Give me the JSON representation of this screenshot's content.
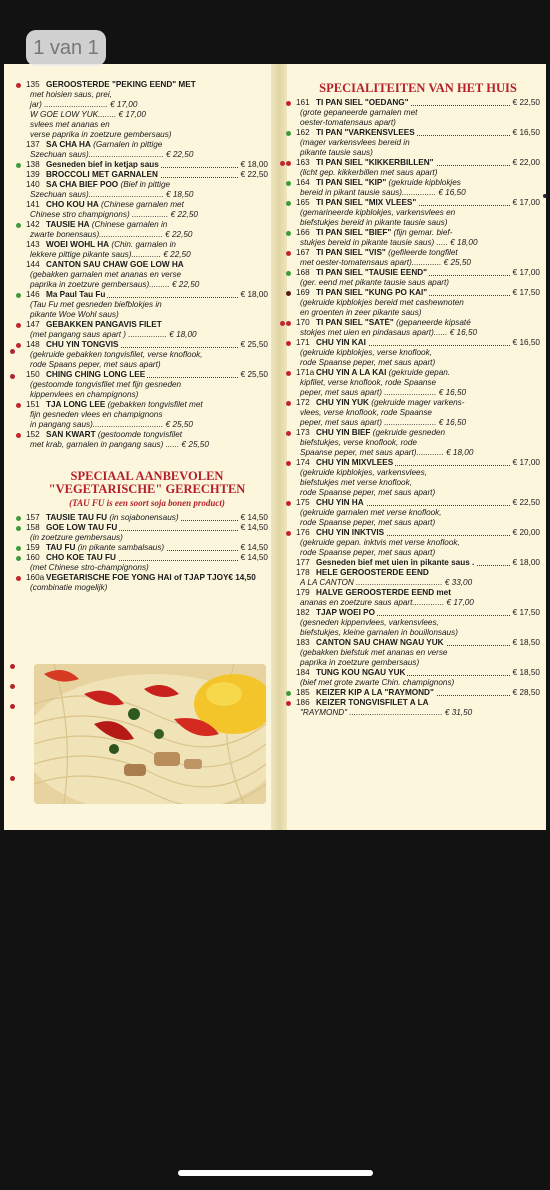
{
  "page_indicator": "1 van 1",
  "right_section": {
    "title": "SPECIALITEITEN VAN HET HUIS"
  },
  "veg_section": {
    "title1": "SPECIAAL AANBEVOLEN",
    "title2": "\"VEGETARISCHE\" GERECHTEN",
    "subtitle": "(TAU FU is een soort soja bonen product)"
  },
  "photo_icon": "food-photo-noodles",
  "colors": {
    "accent_red": "#b51f2a",
    "bullet_green": "#3f9a3a",
    "paper": "#fbf6dc"
  },
  "left_items": [
    {
      "num": "135",
      "name": "GEROOSTERDE \"PEKING EEND\" MET",
      "desc": "",
      "price": "",
      "more": [
        "met hoisien saus, prei,",
        "jar) ............................ € 17,00",
        "W GOE LOW YUK........ € 17,00",
        "svlees met ananas en",
        "verse paprika in zoetzure gembersaus)"
      ]
    },
    {
      "num": "137",
      "name": "SA CHA HA",
      "desc": "(Garnalen in pittige",
      "price": "",
      "more": [
        "Szechuan saus)................................. € 22,50"
      ]
    },
    {
      "num": "138",
      "name": "Gesneden bief in ketjap saus",
      "desc": "",
      "price": "€ 18,00",
      "more": []
    },
    {
      "num": "139",
      "name": "BROCCOLI MET GARNALEN",
      "desc": "",
      "price": "€ 22,50",
      "more": []
    },
    {
      "num": "140",
      "name": "SA CHA BIEF POO",
      "desc": "(Bief in pittige",
      "price": "",
      "more": [
        "Szechuan saus)................................. € 18,50"
      ]
    },
    {
      "num": "141",
      "name": "CHO KOU HA",
      "desc": "(Chinese garnalen met",
      "price": "",
      "more": [
        "Chinese stro champignons) ................ € 22,50"
      ]
    },
    {
      "num": "142",
      "name": "TAUSIE HA",
      "desc": "(Chinese garnalen in",
      "price": "",
      "more": [
        "zwarte bonensaus)............................ € 22,50"
      ]
    },
    {
      "num": "143",
      "name": "WOEI WOHL HA",
      "desc": "(Chin. garnalen in",
      "price": "",
      "more": [
        "lekkere pittige pikante saus)............. € 22,50"
      ]
    },
    {
      "num": "144",
      "name": "CANTON SAU CHAW GOE LOW HA",
      "desc": "",
      "price": "",
      "more": [
        "(gebakken garnalen met ananas en verse",
        "paprika in zoetzure gembersaus)......... € 22,50"
      ]
    },
    {
      "num": "146",
      "name": "Ma Paul Tau Fu",
      "desc": "",
      "price": "€ 18,00",
      "more": [
        "(Tau Fu met gesneden biefblokjes in",
        "pikante Woe Wohl saus)"
      ]
    },
    {
      "num": "147",
      "name": "GEBAKKEN PANGAVIS FILET",
      "desc": "",
      "price": "",
      "more": [
        "(met pangang saus apart ) ................. € 18,00"
      ]
    },
    {
      "num": "148",
      "name": "CHU YIN TONGVIS",
      "desc": "",
      "price": "€ 25,50",
      "more": [
        "(gekruide gebakken tongvisfilet, verse knoflook,",
        "rode Spaans peper, met saus apart)"
      ]
    },
    {
      "num": "150",
      "name": "CHING CHING LONG LEE",
      "desc": "",
      "price": "€ 25,50",
      "more": [
        "(gestoomde tongvisfilet met fijn gesneden",
        "kippenvlees en champignons)"
      ]
    },
    {
      "num": "151",
      "name": "TJA LONG LEE",
      "desc": "(gebakken tongvisfilet met",
      "price": "",
      "more": [
        "fijn gesneden vlees en champignons",
        "in pangang saus)............................... € 25,50"
      ]
    },
    {
      "num": "152",
      "name": "SAN KWART",
      "desc": "(gestoomde tongvisfilet",
      "price": "",
      "more": [
        "met krab, garnalen in pangang saus) ...... € 25,50"
      ]
    }
  ],
  "veg_items": [
    {
      "num": "157",
      "name": "TAUSIE TAU FU",
      "desc": "(in sojabonensaus)",
      "price": "€ 14,50",
      "more": []
    },
    {
      "num": "158",
      "name": "GOE LOW TAU FU",
      "desc": "",
      "price": "€ 14,50",
      "more": [
        "(in zoetzure gembersaus)"
      ]
    },
    {
      "num": "159",
      "name": "TAU FU",
      "desc": "(in pikante sambalsaus)",
      "price": "€ 14,50",
      "more": []
    },
    {
      "num": "160",
      "name": "CHO KOE TAU FU",
      "desc": "",
      "price": "€ 14,50",
      "more": [
        "(met Chinese stro-champignons)"
      ]
    },
    {
      "num": "160a",
      "name": "VEGETARISCHE FOE YONG HAI of TJAP TJOY€ 14,50",
      "desc": "",
      "price": "",
      "more": [
        "(combinatie mogelijk)"
      ]
    }
  ],
  "right_items": [
    {
      "num": "161",
      "name": "TI PAN SIEL \"OEDANG\"",
      "desc": "",
      "price": "€ 22,50",
      "more": [
        "(grote gepaneerde garnalen met",
        "oester-tomatensaus apart)"
      ]
    },
    {
      "num": "162",
      "name": "TI PAN \"VARKENSVLEES",
      "desc": "",
      "price": "€ 16,50",
      "more": [
        "(mager varkensvlees bereid in",
        "pikante tausie saus)"
      ]
    },
    {
      "num": "163",
      "name": "TI PAN SIEL \"KIKKERBILLEN\"",
      "desc": "",
      "price": "€ 22,00",
      "more": [
        "(licht gep. kikkerbillen met saus apart)"
      ]
    },
    {
      "num": "164",
      "name": "TI PAN SIEL \"KIP\"",
      "desc": "(gekruide kipblokjes",
      "price": "",
      "more": [
        "bereid in pikant tausie saus)............... € 16,50"
      ]
    },
    {
      "num": "165",
      "name": "TI PAN SIEL \"MIX VLEES\"",
      "desc": "",
      "price": "€ 17,00",
      "more": [
        "(gemarineerde kipblokjes, varkensvlees en",
        "biefstukjes bereid in pikante tausie saus)"
      ]
    },
    {
      "num": "166",
      "name": "TI PAN SIEL \"BIEF\"",
      "desc": "(fijn gemar. bief-",
      "price": "",
      "more": [
        "stukjes bereid in pikante tausie saus) ..... € 18,00"
      ]
    },
    {
      "num": "167",
      "name": "TI PAN SIEL \"VIS\"",
      "desc": "(gefileerde tongfilet",
      "price": "",
      "more": [
        "met oester-tomatensaus apart)............. € 25,50"
      ]
    },
    {
      "num": "168",
      "name": "TI PAN SIEL \"TAUSIE EEND\"",
      "desc": "",
      "price": "€ 17,00",
      "more": [
        "(ger. eend met pikante tausie saus apart)"
      ]
    },
    {
      "num": "169",
      "name": "TI PAN SIEL \"KUNG PO KAI\"",
      "desc": "",
      "price": "€ 17,50",
      "more": [
        "(gekruide kipblokjes bereid met cashewnoten",
        "en groenten in zeer pikante saus)"
      ]
    },
    {
      "num": "170",
      "name": "TI PAN SIEL \"SATÉ\"",
      "desc": "(gepaneerde kipsaté",
      "price": "",
      "more": [
        "stokjes met uien en pindasaus apart)...... € 16,50"
      ]
    },
    {
      "num": "171",
      "name": "CHU YIN KAI",
      "desc": "",
      "price": "€ 16,50",
      "more": [
        "(gekruide kipblokjes, verse knoflook,",
        "rode Spaanse peper, met saus apart)"
      ]
    },
    {
      "num": "171a",
      "name": "CHU YIN A LA KAI",
      "desc": "(gekruide gepan.",
      "price": "",
      "more": [
        "kipfilet, verse knoflook, rode Spaanse",
        "peper, met saus apart) ....................... € 16,50"
      ]
    },
    {
      "num": "172",
      "name": "CHU YIN YUK",
      "desc": "(gekruide mager varkens-",
      "price": "",
      "more": [
        "vlees, verse knoflook, rode Spaanse",
        "peper, met saus apart) ....................... € 16,50"
      ]
    },
    {
      "num": "173",
      "name": "CHU YIN BIEF",
      "desc": "(gekruide gesneden",
      "price": "",
      "more": [
        "biefstukjes, verse knoflook, rode",
        "Spaanse peper, met saus apart)............ € 18,00"
      ]
    },
    {
      "num": "174",
      "name": "CHU YIN MIXVLEES",
      "desc": "",
      "price": "€ 17,00",
      "more": [
        "(gekruide kipblokjes, varkensvlees,",
        "biefstukjes met verse knoflook,",
        "rode Spaanse peper, met saus apart)"
      ]
    },
    {
      "num": "175",
      "name": "CHU YIN HA",
      "desc": "",
      "price": "€ 22,50",
      "more": [
        "(gekruide garnalen met verse knoflook,",
        "rode Spaanse peper, met saus apart)"
      ]
    },
    {
      "num": "176",
      "name": "CHU YIN INKTVIS",
      "desc": "",
      "price": "€ 20,00",
      "more": [
        "(gekruide gepan. inktvis met verse knoflook,",
        "rode Spaanse peper, met saus apart)"
      ]
    },
    {
      "num": "177",
      "name": "Gesneden bief met uien in pikante saus .",
      "desc": "",
      "price": "€ 18,00",
      "more": []
    },
    {
      "num": "178",
      "name": "HELE GEROOSTERDE EEND",
      "desc": "",
      "price": "",
      "more": [
        "A LA CANTON ...................................... € 33,00"
      ]
    },
    {
      "num": "179",
      "name": "HALVE GEROOSTERDE EEND met",
      "desc": "",
      "price": "",
      "more": [
        "ananas en zoetzure saus apart.............. € 17,00"
      ]
    },
    {
      "num": "182",
      "name": "TJAP WOEI PO",
      "desc": "",
      "price": "€ 17,50",
      "more": [
        "(gesneden kippenvlees, varkensvlees,",
        "biefstukjes, kleine garnalen in bouillonsaus)"
      ]
    },
    {
      "num": "183",
      "name": "CANTON SAU CHAW NGAU YUK",
      "desc": "",
      "price": "€ 18,50",
      "more": [
        "(gebakken biefstuk met ananas en verse",
        "paprika in zoetzure gembersaus)"
      ]
    },
    {
      "num": "184",
      "name": "TUNG KOU NGAU YUK",
      "desc": "",
      "price": "€ 18,50",
      "more": [
        "(bief met grote zwarte Chin. champignons)"
      ]
    },
    {
      "num": "185",
      "name": "KEIZER KIP A LA \"RAYMOND\"",
      "desc": "",
      "price": "€ 28,50",
      "more": []
    },
    {
      "num": "186",
      "name": "KEIZER TONGVISFILET A LA",
      "desc": "",
      "price": "",
      "more": [
        "\"RAYMOND\" ......................................... € 31,50"
      ]
    }
  ]
}
